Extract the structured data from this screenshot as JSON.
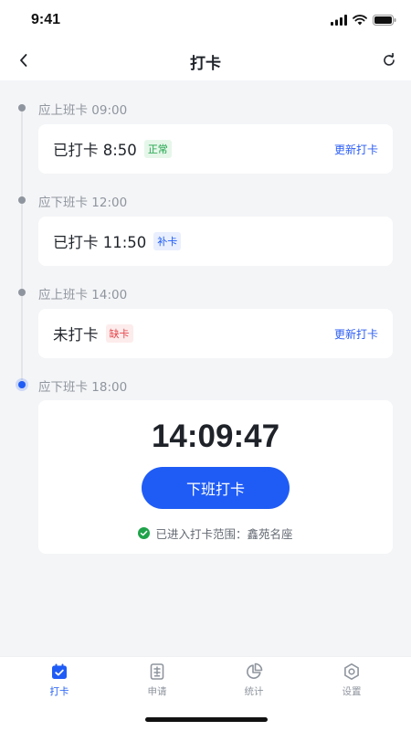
{
  "status_bar": {
    "time": "9:41"
  },
  "nav": {
    "title": "打卡"
  },
  "timeline": [
    {
      "label": "应上班卡 09:00",
      "time_text": "已打卡 8:50",
      "tag": "正常",
      "tag_color": "#1fa34a",
      "action": "更新打卡"
    },
    {
      "label": "应下班卡 12:00",
      "time_text": "已打卡 11:50",
      "tag": "补卡",
      "tag_color": "#1f5cf6"
    },
    {
      "label": "应上班卡 14:00",
      "time_text": "未打卡",
      "tag": "缺卡",
      "tag_color": "#e5484d",
      "action": "更新打卡"
    },
    {
      "label": "应下班卡 18:00"
    }
  ],
  "clock": {
    "current_time": "14:09:47",
    "button_label": "下班打卡",
    "range_text": "已进入打卡范围：鑫苑名座"
  },
  "tabs": [
    {
      "label": "打卡",
      "icon": "calendar-check-icon",
      "active": true
    },
    {
      "label": "申请",
      "icon": "form-icon",
      "active": false
    },
    {
      "label": "统计",
      "icon": "pie-chart-icon",
      "active": false
    },
    {
      "label": "设置",
      "icon": "gear-icon",
      "active": false
    }
  ],
  "colors": {
    "accent": "#1f5cf6",
    "background": "#f4f5f7"
  }
}
